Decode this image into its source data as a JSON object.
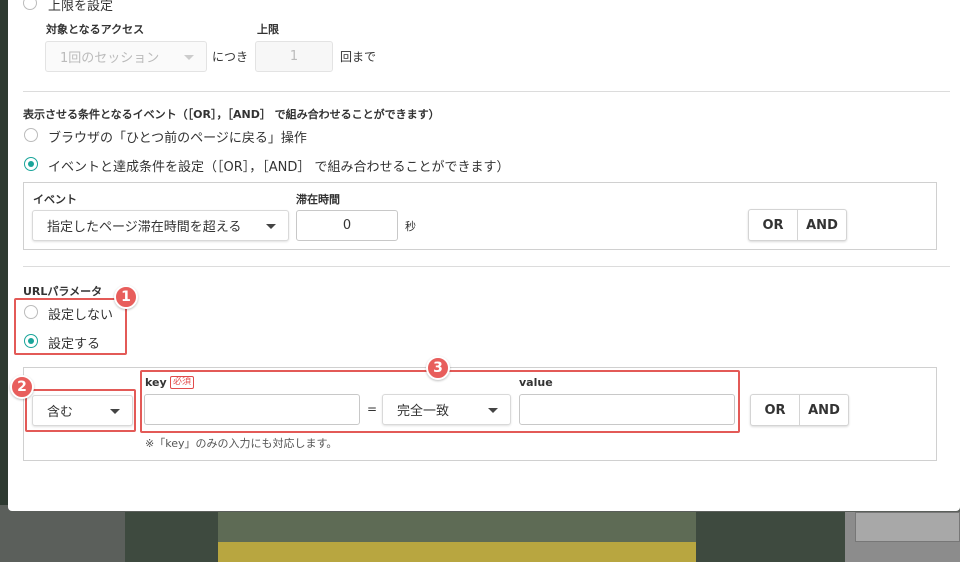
{
  "limit": {
    "radio_label": "上限を設定",
    "access_label": "対象となるアクセス",
    "access_value": "1回のセッション",
    "per_label": "につき",
    "max_label": "上限",
    "max_value": "1",
    "until_label": "回まで"
  },
  "conditions": {
    "heading": "表示させる条件となるイベント（［OR］，［AND］ で組み合わせることができます）",
    "option_back": "ブラウザの「ひとつ前のページに戻る」操作",
    "option_event": "イベントと達成条件を設定（［OR］，［AND］ で組み合わせることができます）",
    "event_label": "イベント",
    "event_value": "指定したページ滞在時間を超える",
    "stay_label": "滞在時間",
    "stay_value": "0",
    "unit": "秒",
    "or_label": "OR",
    "and_label": "AND"
  },
  "url_param": {
    "heading": "URLパラメータ",
    "option_off": "設定しない",
    "option_on": "設定する",
    "contains_value": "含む",
    "key_label": "key",
    "required_badge": "必須",
    "equals": "=",
    "match_value": "完全一致",
    "value_label": "value",
    "note": "※「key」のみの入力にも対応します。",
    "or_label": "OR",
    "and_label": "AND"
  },
  "annotations": [
    "1",
    "2",
    "3"
  ],
  "colors": {
    "accent": "#1aa59a",
    "highlight": "#e35a57"
  }
}
